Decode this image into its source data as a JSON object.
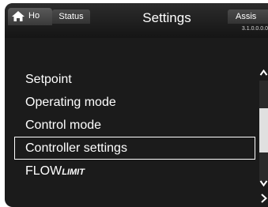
{
  "header": {
    "home_tab": {
      "label": "Ho",
      "icon": "home-icon"
    },
    "status_tab": {
      "label": "Status"
    },
    "title": "Settings",
    "assist_tab": {
      "label": "Assis"
    },
    "version": "3.1.0.0.0.0"
  },
  "menu": {
    "items": [
      {
        "label": "Setpoint"
      },
      {
        "label": "Operating mode"
      },
      {
        "label": "Control mode"
      },
      {
        "label": "Controller settings",
        "selected": true
      },
      {
        "label_main": "FLOW",
        "label_suffix": "LIMIT"
      }
    ]
  },
  "scrollbar": {
    "up_icon": "chevron-up-icon",
    "down_icon": "chevron-down-icon"
  },
  "navigation": {
    "next_icon": "chevron-right-icon"
  },
  "colors": {
    "background": "#1b1b1b",
    "text": "#ffffff",
    "selection_border": "#ffffff"
  }
}
